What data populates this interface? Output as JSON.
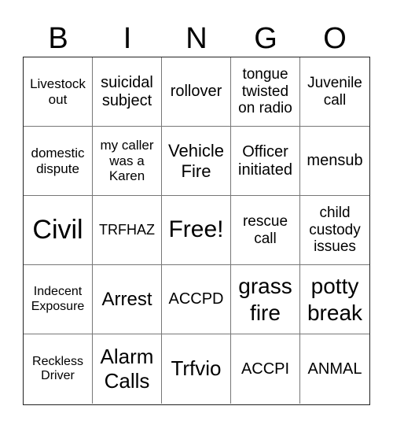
{
  "header": {
    "letters": [
      "B",
      "I",
      "N",
      "G",
      "O"
    ]
  },
  "cells": [
    "Livestock out",
    "suicidal subject",
    "rollover",
    "tongue twisted on radio",
    "Juvenile call",
    "domestic dispute",
    "my caller was a Karen",
    "Vehicle Fire",
    "Officer initiated",
    "mensub",
    "Civil",
    "TRFHAZ",
    "Free!",
    "rescue call",
    "child custody issues",
    "Indecent Exposure",
    "Arrest",
    "ACCPD",
    "grass fire",
    "potty break",
    "Reckless Driver",
    "Alarm Calls",
    "Trfvio",
    "ACCPI",
    "ANMAL"
  ]
}
